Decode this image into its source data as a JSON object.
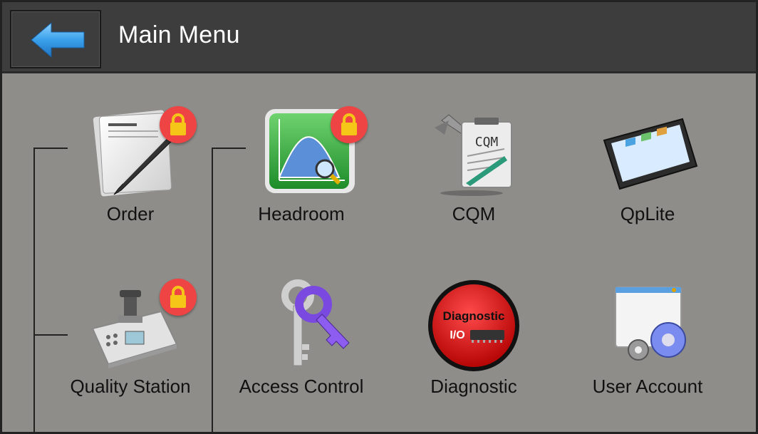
{
  "header": {
    "title": "Main Menu",
    "back_icon": "back-arrow-icon"
  },
  "menu": {
    "items": [
      {
        "label": "Order",
        "icon": "order-document-pen-icon",
        "locked": true
      },
      {
        "label": "Headroom",
        "icon": "headroom-chart-icon",
        "locked": true
      },
      {
        "label": "CQM",
        "icon": "cqm-clipboard-wrench-icon",
        "locked": false
      },
      {
        "label": "QpLite",
        "icon": "tablet-device-icon",
        "locked": false
      },
      {
        "label": "Quality Station",
        "icon": "quality-station-device-icon",
        "locked": true
      },
      {
        "label": "Access Control",
        "icon": "keys-icon",
        "locked": false
      },
      {
        "label": "Diagnostic",
        "icon": "diagnostic-io-icon",
        "locked": false,
        "badge_text": "Diagnostic",
        "badge_subtext": "I/O"
      },
      {
        "label": "User Account",
        "icon": "user-account-gears-icon",
        "locked": false
      }
    ]
  },
  "colors": {
    "header_bg": "#3d3d3d",
    "content_bg": "#8e8d89",
    "lock_badge": "#e44",
    "back_arrow": "#3aa0ea"
  }
}
